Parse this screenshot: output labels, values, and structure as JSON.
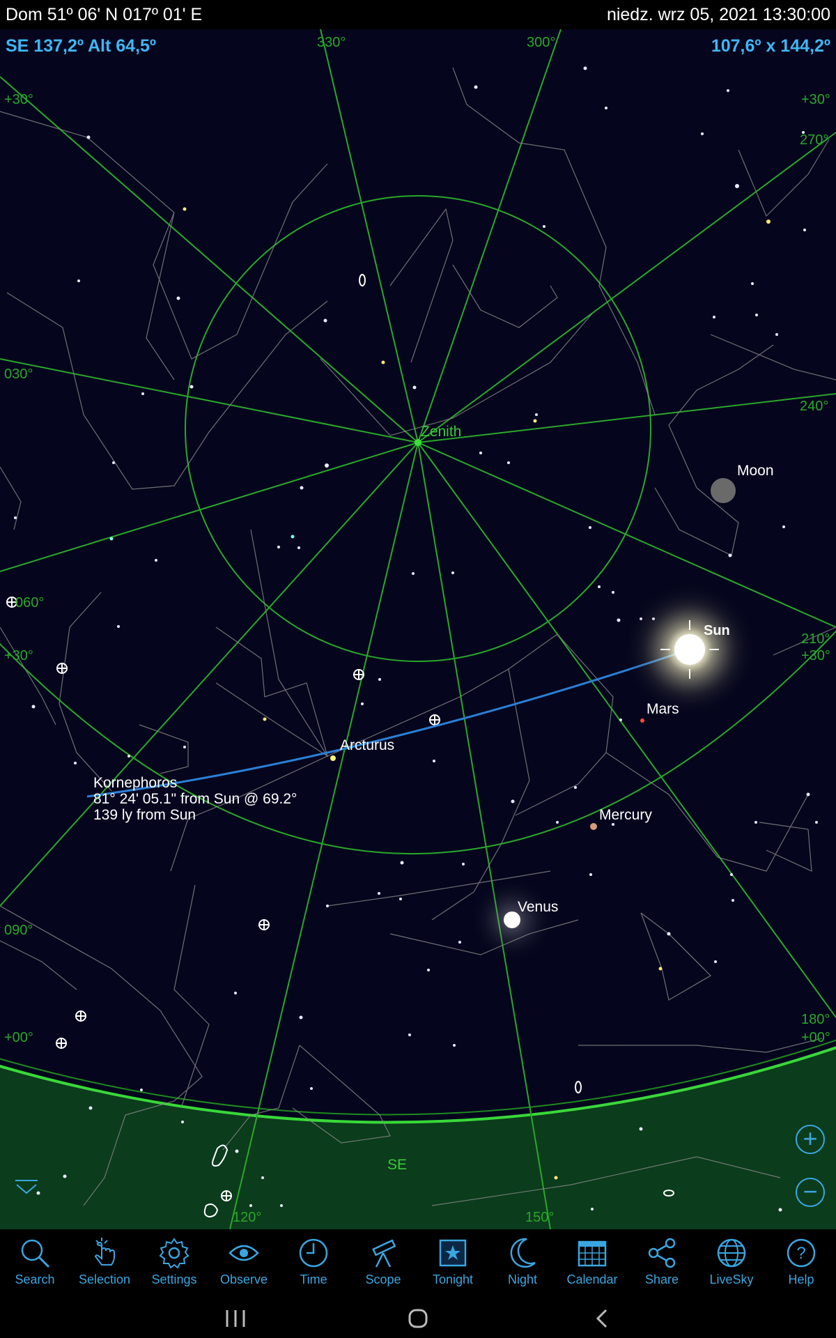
{
  "status_bar": {
    "location": "Dom  51º 06' N 017º 01' E",
    "datetime": "niedz. wrz 05, 2021  13:30:00"
  },
  "sky_view": {
    "view_direction": "SE 137,2º Alt 64,5º",
    "field_of_view": "107,6º x 144,2º",
    "zenith_label": "Zenith",
    "horizon_label": "SE",
    "azimuth_labels": [
      "330°",
      "300°",
      "270°",
      "240°",
      "210°",
      "180°",
      "150°",
      "120°",
      "090°",
      "060°",
      "030°"
    ],
    "altitude_labels": [
      "+30°",
      "+00°"
    ],
    "objects": {
      "moon": "Moon",
      "sun": "Sun",
      "mars": "Mars",
      "mercury": "Mercury",
      "venus": "Venus",
      "arcturus": "Arcturus"
    },
    "selection_info": {
      "name": "Kornephoros",
      "line1": "81° 24' 05.1\" from Sun @ 69.2°",
      "line2": "139 ly from Sun"
    },
    "zoom_in": "+",
    "zoom_out": "−",
    "colors": {
      "sky": "#05061d",
      "grid": "#2aa82a",
      "label_green": "#3acb3a",
      "horizon_fill": "#0b3c1c",
      "accent_blue": "#3fb7f4",
      "selection_line": "#2b7fd6"
    }
  },
  "toolbar": {
    "items": [
      {
        "label": "Search",
        "icon": "magnifier"
      },
      {
        "label": "Selection",
        "icon": "hand-pointer"
      },
      {
        "label": "Settings",
        "icon": "gear"
      },
      {
        "label": "Observe",
        "icon": "eye"
      },
      {
        "label": "Time",
        "icon": "clock"
      },
      {
        "label": "Scope",
        "icon": "telescope"
      },
      {
        "label": "Tonight",
        "icon": "star-box"
      },
      {
        "label": "Night",
        "icon": "crescent-moon"
      },
      {
        "label": "Calendar",
        "icon": "calendar"
      },
      {
        "label": "Share",
        "icon": "share"
      },
      {
        "label": "LiveSky",
        "icon": "globe"
      },
      {
        "label": "Help",
        "icon": "question"
      }
    ]
  }
}
